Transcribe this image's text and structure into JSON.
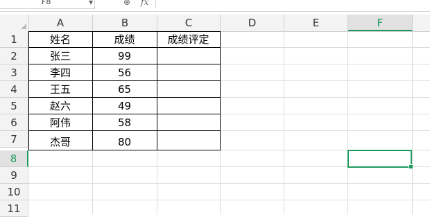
{
  "formula_bar": {
    "name_box": "F8",
    "fx_label": "fx"
  },
  "columns": [
    "A",
    "B",
    "C",
    "D",
    "E",
    "F"
  ],
  "rows": [
    "1",
    "2",
    "3",
    "4",
    "5",
    "6",
    "7",
    "8",
    "9",
    "10",
    "11"
  ],
  "active_cell": {
    "column": "F",
    "row": "8"
  },
  "cells": {
    "A1": "姓名",
    "B1": "成绩",
    "C1": "成绩评定",
    "A2": "张三",
    "B2": "99",
    "A3": "李四",
    "B3": "56",
    "A4": "王五",
    "B4": "65",
    "A5": "赵六",
    "B5": "49",
    "A6": "阿伟",
    "B6": "58",
    "A7": "杰哥",
    "B7": "80"
  },
  "colors": {
    "accent": "#1d9b5e",
    "header_bg": "#f3f3f3",
    "gridline": "#dcdcdc"
  }
}
